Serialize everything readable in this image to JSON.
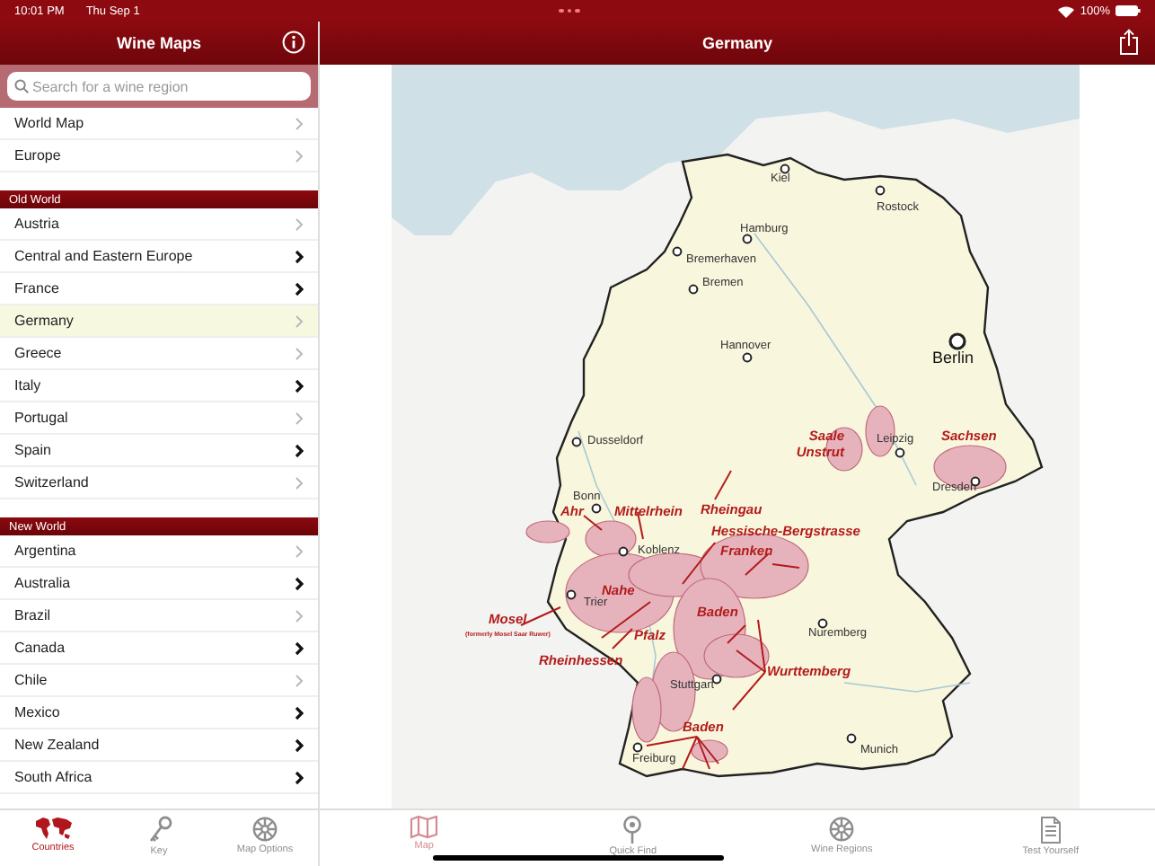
{
  "status_bar": {
    "time": "10:01 PM",
    "date": "Thu Sep 1",
    "battery": "100%"
  },
  "sidebar": {
    "title": "Wine Maps",
    "search": {
      "placeholder": "Search for a wine region"
    },
    "top_items": [
      {
        "label": "World Map",
        "selected": false,
        "emphasized": false
      },
      {
        "label": "Europe",
        "selected": false,
        "emphasized": false
      }
    ],
    "sections": [
      {
        "header": "Old World",
        "items": [
          {
            "label": "Austria",
            "selected": false,
            "emphasized": false
          },
          {
            "label": "Central and Eastern Europe",
            "selected": false,
            "emphasized": true
          },
          {
            "label": "France",
            "selected": false,
            "emphasized": true
          },
          {
            "label": "Germany",
            "selected": true,
            "emphasized": false
          },
          {
            "label": "Greece",
            "selected": false,
            "emphasized": false
          },
          {
            "label": "Italy",
            "selected": false,
            "emphasized": true
          },
          {
            "label": "Portugal",
            "selected": false,
            "emphasized": false
          },
          {
            "label": "Spain",
            "selected": false,
            "emphasized": true
          },
          {
            "label": "Switzerland",
            "selected": false,
            "emphasized": false
          }
        ]
      },
      {
        "header": "New World",
        "items": [
          {
            "label": "Argentina",
            "selected": false,
            "emphasized": false
          },
          {
            "label": "Australia",
            "selected": false,
            "emphasized": true
          },
          {
            "label": "Brazil",
            "selected": false,
            "emphasized": false
          },
          {
            "label": "Canada",
            "selected": false,
            "emphasized": true
          },
          {
            "label": "Chile",
            "selected": false,
            "emphasized": false
          },
          {
            "label": "Mexico",
            "selected": false,
            "emphasized": true
          },
          {
            "label": "New Zealand",
            "selected": false,
            "emphasized": true
          },
          {
            "label": "South Africa",
            "selected": false,
            "emphasized": true
          }
        ]
      }
    ],
    "tabs": [
      {
        "label": "Countries",
        "kind": "globe",
        "selected": true
      },
      {
        "label": "Key",
        "kind": "key",
        "selected": false
      },
      {
        "label": "Map Options",
        "kind": "gear",
        "selected": false
      }
    ]
  },
  "detail": {
    "title": "Germany",
    "map": {
      "cities": [
        {
          "name": "Kiel",
          "capital": false
        },
        {
          "name": "Rostock",
          "capital": false
        },
        {
          "name": "Hamburg",
          "capital": false
        },
        {
          "name": "Bremerhaven",
          "capital": false
        },
        {
          "name": "Bremen",
          "capital": false
        },
        {
          "name": "Hannover",
          "capital": false
        },
        {
          "name": "Berlin",
          "capital": true
        },
        {
          "name": "Dusseldorf",
          "capital": false
        },
        {
          "name": "Leipzig",
          "capital": false
        },
        {
          "name": "Dresden",
          "capital": false
        },
        {
          "name": "Bonn",
          "capital": false
        },
        {
          "name": "Koblenz",
          "capital": false
        },
        {
          "name": "Trier",
          "capital": false
        },
        {
          "name": "Nuremberg",
          "capital": false
        },
        {
          "name": "Stuttgart",
          "capital": false
        },
        {
          "name": "Munich",
          "capital": false
        },
        {
          "name": "Freiburg",
          "capital": false
        }
      ],
      "regions": [
        {
          "name": "Saale Unstrut"
        },
        {
          "name": "Sachsen"
        },
        {
          "name": "Ahr"
        },
        {
          "name": "Mittelrhein"
        },
        {
          "name": "Rheingau"
        },
        {
          "name": "Hessische-Bergstrasse"
        },
        {
          "name": "Franken"
        },
        {
          "name": "Nahe"
        },
        {
          "name": "Baden"
        },
        {
          "name": "Mosel",
          "note": "(formerly Mosel Saar Ruwer)"
        },
        {
          "name": "Pfalz"
        },
        {
          "name": "Rheinhessen"
        },
        {
          "name": "Wurttemberg"
        },
        {
          "name": "Baden"
        }
      ]
    },
    "tabs": [
      {
        "label": "Map",
        "kind": "map",
        "selected": true
      },
      {
        "label": "Quick Find",
        "kind": "pin",
        "selected": false
      },
      {
        "label": "Wine Regions",
        "kind": "gear",
        "selected": false
      },
      {
        "label": "Test Yourself",
        "kind": "document",
        "selected": false
      }
    ]
  }
}
